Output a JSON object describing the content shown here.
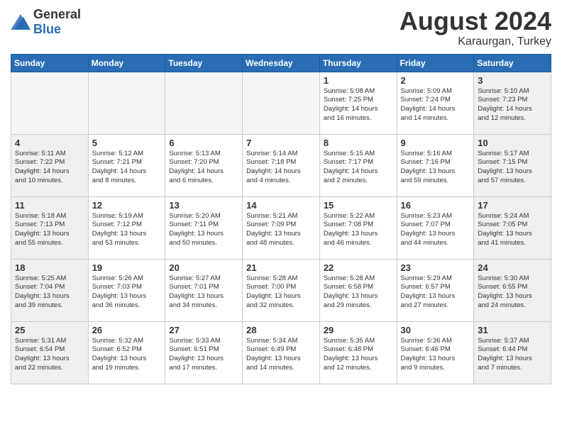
{
  "logo": {
    "general": "General",
    "blue": "Blue"
  },
  "header": {
    "month_year": "August 2024",
    "location": "Karaurgan, Turkey"
  },
  "weekdays": [
    "Sunday",
    "Monday",
    "Tuesday",
    "Wednesday",
    "Thursday",
    "Friday",
    "Saturday"
  ],
  "weeks": [
    [
      {
        "day": "",
        "info": "",
        "empty": true
      },
      {
        "day": "",
        "info": "",
        "empty": true
      },
      {
        "day": "",
        "info": "",
        "empty": true
      },
      {
        "day": "",
        "info": "",
        "empty": true
      },
      {
        "day": "1",
        "info": "Sunrise: 5:08 AM\nSunset: 7:25 PM\nDaylight: 14 hours\nand 16 minutes.",
        "empty": false,
        "shaded": false
      },
      {
        "day": "2",
        "info": "Sunrise: 5:09 AM\nSunset: 7:24 PM\nDaylight: 14 hours\nand 14 minutes.",
        "empty": false,
        "shaded": false
      },
      {
        "day": "3",
        "info": "Sunrise: 5:10 AM\nSunset: 7:23 PM\nDaylight: 14 hours\nand 12 minutes.",
        "empty": false,
        "shaded": true
      }
    ],
    [
      {
        "day": "4",
        "info": "Sunrise: 5:11 AM\nSunset: 7:22 PM\nDaylight: 14 hours\nand 10 minutes.",
        "empty": false,
        "shaded": true
      },
      {
        "day": "5",
        "info": "Sunrise: 5:12 AM\nSunset: 7:21 PM\nDaylight: 14 hours\nand 8 minutes.",
        "empty": false,
        "shaded": false
      },
      {
        "day": "6",
        "info": "Sunrise: 5:13 AM\nSunset: 7:20 PM\nDaylight: 14 hours\nand 6 minutes.",
        "empty": false,
        "shaded": false
      },
      {
        "day": "7",
        "info": "Sunrise: 5:14 AM\nSunset: 7:18 PM\nDaylight: 14 hours\nand 4 minutes.",
        "empty": false,
        "shaded": false
      },
      {
        "day": "8",
        "info": "Sunrise: 5:15 AM\nSunset: 7:17 PM\nDaylight: 14 hours\nand 2 minutes.",
        "empty": false,
        "shaded": false
      },
      {
        "day": "9",
        "info": "Sunrise: 5:16 AM\nSunset: 7:16 PM\nDaylight: 13 hours\nand 59 minutes.",
        "empty": false,
        "shaded": false
      },
      {
        "day": "10",
        "info": "Sunrise: 5:17 AM\nSunset: 7:15 PM\nDaylight: 13 hours\nand 57 minutes.",
        "empty": false,
        "shaded": true
      }
    ],
    [
      {
        "day": "11",
        "info": "Sunrise: 5:18 AM\nSunset: 7:13 PM\nDaylight: 13 hours\nand 55 minutes.",
        "empty": false,
        "shaded": true
      },
      {
        "day": "12",
        "info": "Sunrise: 5:19 AM\nSunset: 7:12 PM\nDaylight: 13 hours\nand 53 minutes.",
        "empty": false,
        "shaded": false
      },
      {
        "day": "13",
        "info": "Sunrise: 5:20 AM\nSunset: 7:11 PM\nDaylight: 13 hours\nand 50 minutes.",
        "empty": false,
        "shaded": false
      },
      {
        "day": "14",
        "info": "Sunrise: 5:21 AM\nSunset: 7:09 PM\nDaylight: 13 hours\nand 48 minutes.",
        "empty": false,
        "shaded": false
      },
      {
        "day": "15",
        "info": "Sunrise: 5:22 AM\nSunset: 7:08 PM\nDaylight: 13 hours\nand 46 minutes.",
        "empty": false,
        "shaded": false
      },
      {
        "day": "16",
        "info": "Sunrise: 5:23 AM\nSunset: 7:07 PM\nDaylight: 13 hours\nand 44 minutes.",
        "empty": false,
        "shaded": false
      },
      {
        "day": "17",
        "info": "Sunrise: 5:24 AM\nSunset: 7:05 PM\nDaylight: 13 hours\nand 41 minutes.",
        "empty": false,
        "shaded": true
      }
    ],
    [
      {
        "day": "18",
        "info": "Sunrise: 5:25 AM\nSunset: 7:04 PM\nDaylight: 13 hours\nand 39 minutes.",
        "empty": false,
        "shaded": true
      },
      {
        "day": "19",
        "info": "Sunrise: 5:26 AM\nSunset: 7:03 PM\nDaylight: 13 hours\nand 36 minutes.",
        "empty": false,
        "shaded": false
      },
      {
        "day": "20",
        "info": "Sunrise: 5:27 AM\nSunset: 7:01 PM\nDaylight: 13 hours\nand 34 minutes.",
        "empty": false,
        "shaded": false
      },
      {
        "day": "21",
        "info": "Sunrise: 5:28 AM\nSunset: 7:00 PM\nDaylight: 13 hours\nand 32 minutes.",
        "empty": false,
        "shaded": false
      },
      {
        "day": "22",
        "info": "Sunrise: 5:28 AM\nSunset: 6:58 PM\nDaylight: 13 hours\nand 29 minutes.",
        "empty": false,
        "shaded": false
      },
      {
        "day": "23",
        "info": "Sunrise: 5:29 AM\nSunset: 6:57 PM\nDaylight: 13 hours\nand 27 minutes.",
        "empty": false,
        "shaded": false
      },
      {
        "day": "24",
        "info": "Sunrise: 5:30 AM\nSunset: 6:55 PM\nDaylight: 13 hours\nand 24 minutes.",
        "empty": false,
        "shaded": true
      }
    ],
    [
      {
        "day": "25",
        "info": "Sunrise: 5:31 AM\nSunset: 6:54 PM\nDaylight: 13 hours\nand 22 minutes.",
        "empty": false,
        "shaded": true
      },
      {
        "day": "26",
        "info": "Sunrise: 5:32 AM\nSunset: 6:52 PM\nDaylight: 13 hours\nand 19 minutes.",
        "empty": false,
        "shaded": false
      },
      {
        "day": "27",
        "info": "Sunrise: 5:33 AM\nSunset: 6:51 PM\nDaylight: 13 hours\nand 17 minutes.",
        "empty": false,
        "shaded": false
      },
      {
        "day": "28",
        "info": "Sunrise: 5:34 AM\nSunset: 6:49 PM\nDaylight: 13 hours\nand 14 minutes.",
        "empty": false,
        "shaded": false
      },
      {
        "day": "29",
        "info": "Sunrise: 5:35 AM\nSunset: 6:48 PM\nDaylight: 13 hours\nand 12 minutes.",
        "empty": false,
        "shaded": false
      },
      {
        "day": "30",
        "info": "Sunrise: 5:36 AM\nSunset: 6:46 PM\nDaylight: 13 hours\nand 9 minutes.",
        "empty": false,
        "shaded": false
      },
      {
        "day": "31",
        "info": "Sunrise: 5:37 AM\nSunset: 6:44 PM\nDaylight: 13 hours\nand 7 minutes.",
        "empty": false,
        "shaded": true
      }
    ]
  ]
}
